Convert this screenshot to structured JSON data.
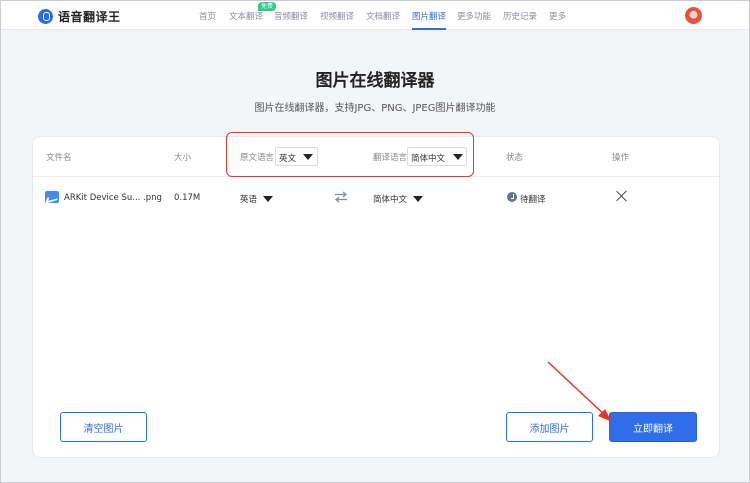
{
  "header": {
    "logo_text": "语音翻译王",
    "nav": [
      {
        "label": "首页"
      },
      {
        "label": "文本翻译"
      },
      {
        "label": "音频翻译"
      },
      {
        "label": "视频翻译"
      },
      {
        "label": "文档翻译"
      },
      {
        "label": "图片翻译"
      },
      {
        "label": "更多功能"
      },
      {
        "label": "历史记录"
      },
      {
        "label": "更多"
      }
    ],
    "free_badge": "免费",
    "active_nav": "图片翻译"
  },
  "main": {
    "title": "图片在线翻译器",
    "subtitle": "图片在线翻译器，支持JPG、PNG、JPEG图片翻译功能"
  },
  "table": {
    "headers": {
      "filename": "文件名",
      "size": "大小",
      "source_lang": "原文语言",
      "target_lang": "翻译语言",
      "status": "状态",
      "actions": "操作"
    },
    "source_lang_value": "英文",
    "target_lang_value": "简体中文",
    "rows": [
      {
        "filename": "ARKit Device Su... .png",
        "size": "0.17M",
        "source_lang": "英语",
        "target_lang": "简体中文",
        "status": "待翻译"
      }
    ]
  },
  "buttons": {
    "clear": "清空图片",
    "add": "添加图片",
    "translate": "立即翻译"
  },
  "colors": {
    "accent": "#2f6ee8",
    "highlight": "#e03a2c"
  }
}
